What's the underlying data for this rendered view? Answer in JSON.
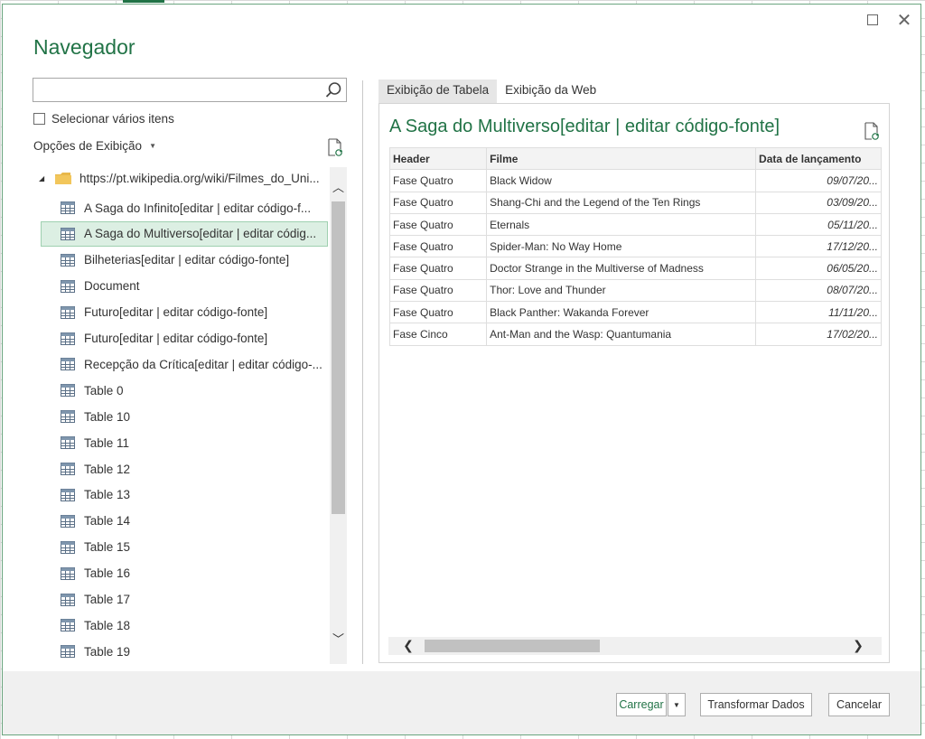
{
  "dialog": {
    "title": "Navegador"
  },
  "search": {
    "placeholder": "",
    "value": ""
  },
  "multi_select": {
    "label": "Selecionar vários itens",
    "checked": false
  },
  "view_options": {
    "label": "Opções de Exibição"
  },
  "tree": {
    "root": "https://pt.wikipedia.org/wiki/Filmes_do_Uni...",
    "items": [
      {
        "label": "A Saga do Infinito[editar | editar código-f..."
      },
      {
        "label": "A Saga do Multiverso[editar | editar códig..."
      },
      {
        "label": "Bilheterias[editar | editar código-fonte]"
      },
      {
        "label": "Document"
      },
      {
        "label": "Futuro[editar | editar código-fonte]"
      },
      {
        "label": "Futuro[editar | editar código-fonte]"
      },
      {
        "label": "Recepção da Crítica[editar | editar código-..."
      },
      {
        "label": "Table 0"
      },
      {
        "label": "Table 10"
      },
      {
        "label": "Table 11"
      },
      {
        "label": "Table 12"
      },
      {
        "label": "Table 13"
      },
      {
        "label": "Table 14"
      },
      {
        "label": "Table 15"
      },
      {
        "label": "Table 16"
      },
      {
        "label": "Table 17"
      },
      {
        "label": "Table 18"
      },
      {
        "label": "Table 19"
      }
    ],
    "selected_index": 1
  },
  "tabs": [
    {
      "label": "Exibição de Tabela",
      "active": true
    },
    {
      "label": "Exibição da Web",
      "active": false
    }
  ],
  "preview": {
    "title": "A Saga do Multiverso[editar | editar código-fonte]",
    "columns": [
      "Header",
      "Filme",
      "Data de lançamento"
    ],
    "rows": [
      [
        "Fase Quatro",
        "Black Widow",
        "09/07/20..."
      ],
      [
        "Fase Quatro",
        "Shang-Chi and the Legend of the Ten Rings",
        "03/09/20..."
      ],
      [
        "Fase Quatro",
        "Eternals",
        "05/11/20..."
      ],
      [
        "Fase Quatro",
        "Spider-Man: No Way Home",
        "17/12/20..."
      ],
      [
        "Fase Quatro",
        "Doctor Strange in the Multiverse of Madness",
        "06/05/20..."
      ],
      [
        "Fase Quatro",
        "Thor: Love and Thunder",
        "08/07/20..."
      ],
      [
        "Fase Quatro",
        "Black Panther: Wakanda Forever",
        "11/11/20..."
      ],
      [
        "Fase Cinco",
        "Ant-Man and the Wasp: Quantumania",
        "17/02/20..."
      ]
    ]
  },
  "footer": {
    "load_label": "Carregar",
    "transform_label": "Transformar Dados",
    "cancel_label": "Cancelar"
  },
  "colors": {
    "accent": "#217346",
    "selected_bg": "#dcefe3"
  }
}
